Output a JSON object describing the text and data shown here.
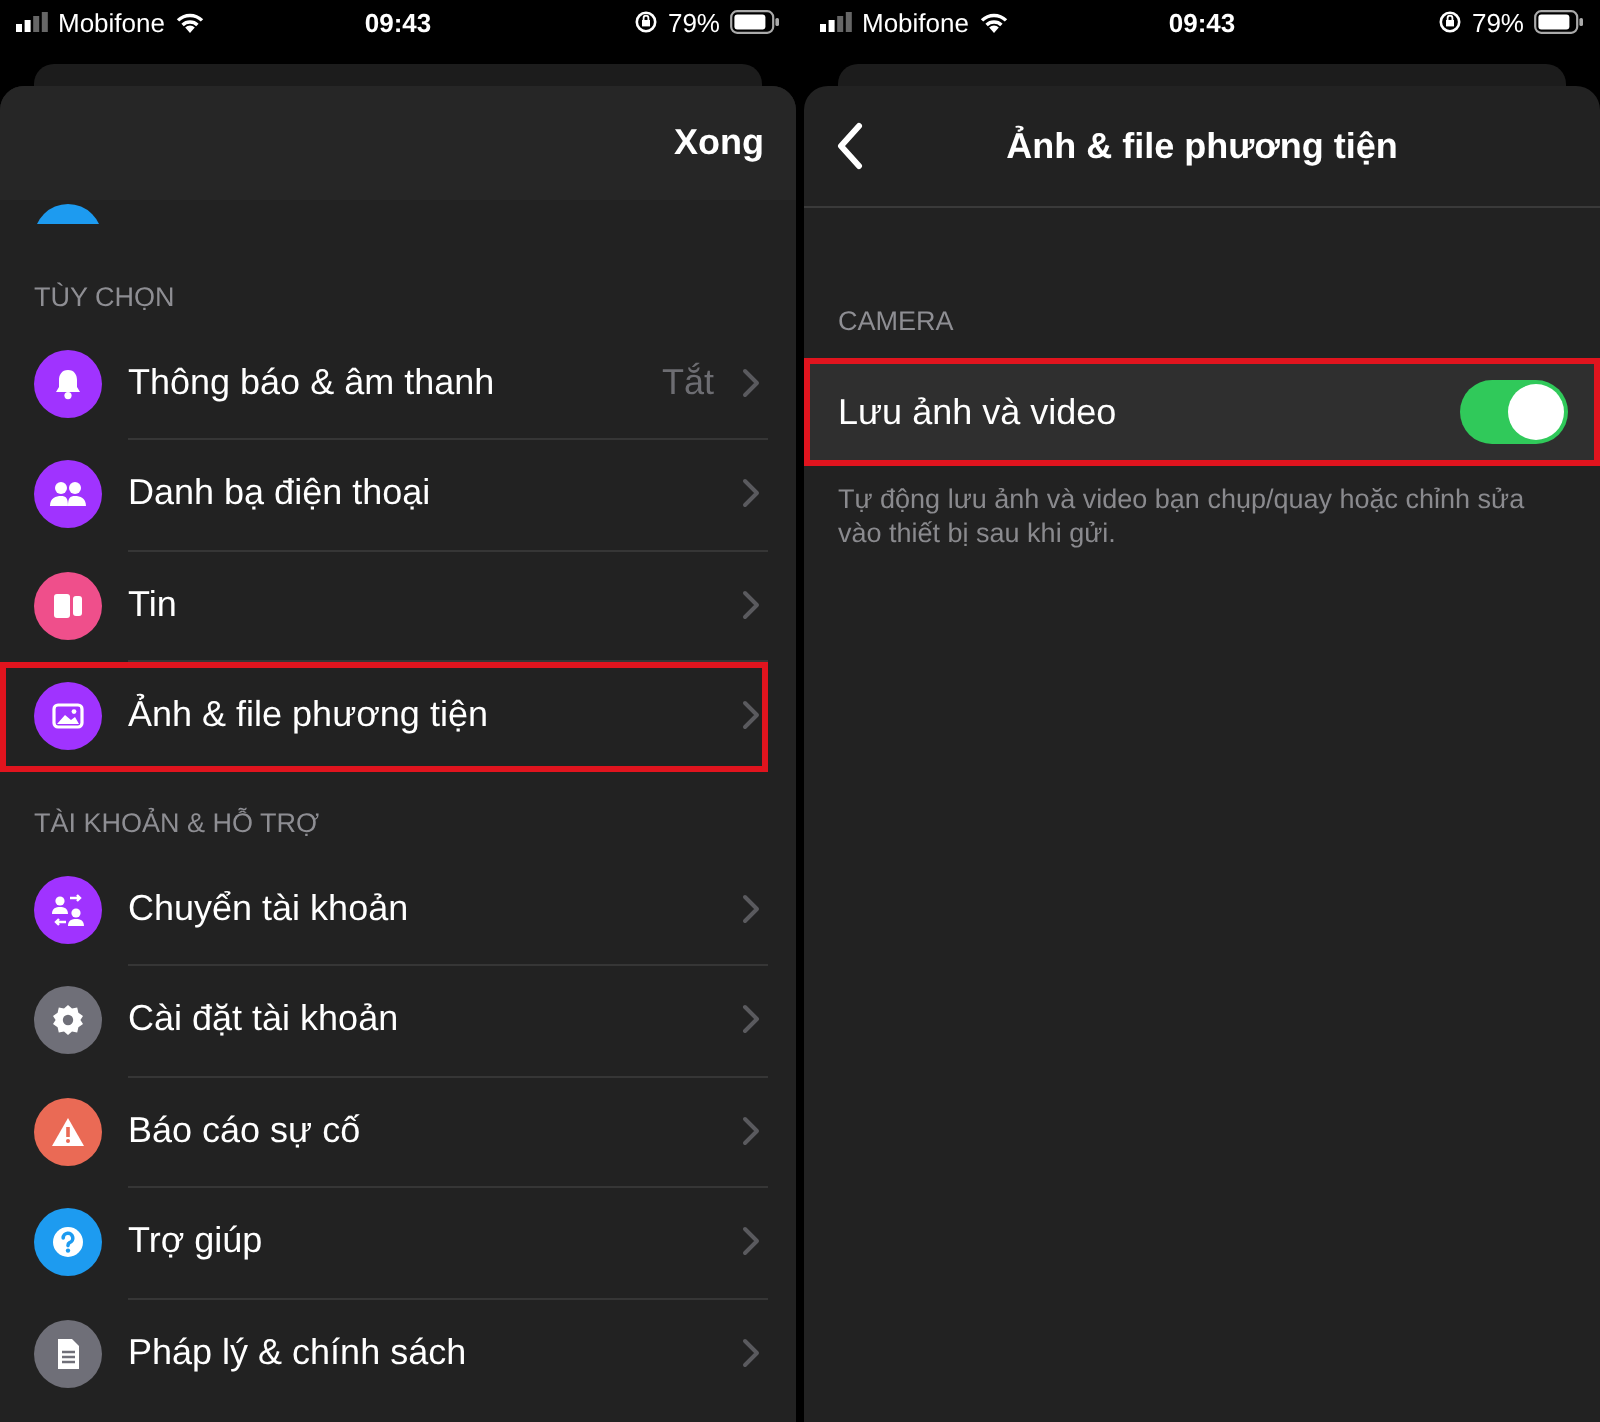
{
  "left_screen": {
    "status_bar": {
      "carrier": "Mobifone",
      "time": "09:43",
      "battery": "79%"
    },
    "header": {
      "action": "Xong"
    },
    "hidden_row": {
      "color": "#1d9bf0"
    },
    "sections": [
      {
        "title": "TÙY CHỌN",
        "items": [
          {
            "label": "Thông báo & âm thanh",
            "value": "Tắt",
            "kind": "bell",
            "color": "#a033ff",
            "highlighted": false
          },
          {
            "label": "Danh bạ điện thoại",
            "kind": "people",
            "color": "#a033ff",
            "highlighted": false
          },
          {
            "label": "Tin",
            "kind": "story",
            "color": "#ef4f8b",
            "highlighted": false
          },
          {
            "label": "Ảnh & file phương tiện",
            "kind": "image",
            "color": "#a033ff",
            "highlighted": true
          }
        ]
      },
      {
        "title": "TÀI KHOẢN & HỖ TRỢ",
        "items": [
          {
            "label": "Chuyển tài khoản",
            "kind": "switch",
            "color": "#a033ff",
            "highlighted": false
          },
          {
            "label": "Cài đặt tài khoản",
            "kind": "gear",
            "color": "#6f6f78",
            "highlighted": false
          },
          {
            "label": "Báo cáo sự cố",
            "kind": "warning",
            "color": "#ea6a55",
            "highlighted": false
          },
          {
            "label": "Trợ giúp",
            "kind": "help",
            "color": "#1d9bf0",
            "highlighted": false
          },
          {
            "label": "Pháp lý & chính sách",
            "kind": "document",
            "color": "#6f6f78",
            "highlighted": false
          }
        ]
      }
    ]
  },
  "right_screen": {
    "status_bar": {
      "carrier": "Mobifone",
      "time": "09:43",
      "battery": "79%"
    },
    "header": {
      "title": "Ảnh & file phương tiện"
    },
    "sections": [
      {
        "title": "CAMERA",
        "items": [
          {
            "label": "Lưu ảnh và video",
            "on": true,
            "highlighted": true
          }
        ],
        "note": "Tự động lưu ảnh và video bạn chụp/quay hoặc chỉnh sửa vào thiết bị sau khi gửi."
      }
    ]
  }
}
